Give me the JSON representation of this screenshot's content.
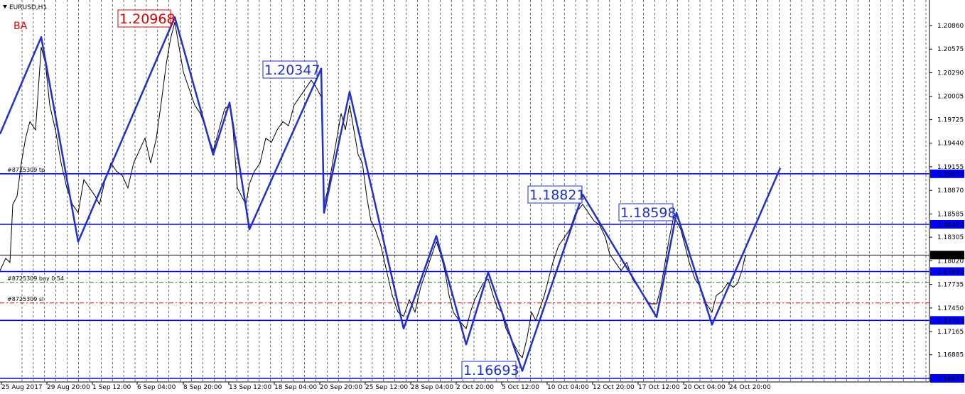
{
  "symbol_title": "EURUSD,H1",
  "indicator_label": "BA",
  "colors": {
    "level_line": "#0000ff",
    "zigzag": "#1f2fd4",
    "price_line": "#000000",
    "current_price_bg": "#000000",
    "level_badge_bg": "#0000ff",
    "high_label_red": "#e00000",
    "grid": "#000000"
  },
  "order_labels": {
    "tp": "#8725309 tp",
    "buy": "#8725309 buy 0.54",
    "sl": "#8725309 sl"
  },
  "price_labels": [
    {
      "text": "1.20968",
      "color": "red"
    },
    {
      "text": "1.20347",
      "color": "blue"
    },
    {
      "text": "1.18821",
      "color": "blue"
    },
    {
      "text": "1.18598",
      "color": "blue"
    },
    {
      "text": "1.16693",
      "color": "blue"
    }
  ],
  "chart_data": {
    "type": "line",
    "ylim": [
      1.1655,
      1.2106
    ],
    "y_ticks": [
      "1.20860",
      "1.20575",
      "1.20290",
      "1.20005",
      "1.19725",
      "1.19440",
      "1.19155",
      "1.18870",
      "1.18585",
      "1.18305",
      "1.18020",
      "1.17735",
      "1.17450",
      "1.17165",
      "1.16885",
      "1.16600"
    ],
    "x_ticks": [
      "25 Aug 2017",
      "29 Aug 20:00",
      "1 Sep 12:00",
      "6 Sep 04:00",
      "8 Sep 20:00",
      "13 Sep 12:00",
      "18 Sep 04:00",
      "20 Sep 20:00",
      "25 Sep 12:00",
      "28 Sep 04:00",
      "2 Oct 20:00",
      "5 Oct 12:00",
      "10 Oct 04:00",
      "12 Oct 20:00",
      "17 Oct 12:00",
      "20 Oct 04:00",
      "24 Oct 20:00"
    ],
    "horizontal_levels": [
      {
        "value": 1.1907,
        "label": "1.19070"
      },
      {
        "value": 1.1846,
        "label": "1.18460"
      },
      {
        "value": 1.1789,
        "label": "1.17890"
      },
      {
        "value": 1.173,
        "label": "1.17300"
      },
      {
        "value": 1.166,
        "label": "1.16600"
      }
    ],
    "current_price": {
      "value": 1.18089,
      "label": "1.18089"
    },
    "buy_level": 1.1776,
    "sl_level": 1.1751,
    "zigzag": [
      [
        0,
        1.1955
      ],
      [
        58,
        1.2072
      ],
      [
        110,
        1.1825
      ],
      [
        246,
        1.2096
      ],
      [
        300,
        1.193
      ],
      [
        323,
        1.1993
      ],
      [
        351,
        1.184
      ],
      [
        452,
        1.2034
      ],
      [
        456,
        1.186
      ],
      [
        492,
        1.2006
      ],
      [
        568,
        1.172
      ],
      [
        614,
        1.1832
      ],
      [
        656,
        1.1701
      ],
      [
        687,
        1.1788
      ],
      [
        735,
        1.1669
      ],
      [
        820,
        1.1882
      ],
      [
        924,
        1.1734
      ],
      [
        952,
        1.186
      ],
      [
        1002,
        1.1725
      ],
      [
        1098,
        1.1914
      ]
    ],
    "price_series": [
      [
        0,
        1.179
      ],
      [
        8,
        1.1805
      ],
      [
        14,
        1.18
      ],
      [
        18,
        1.187
      ],
      [
        24,
        1.188
      ],
      [
        30,
        1.192
      ],
      [
        36,
        1.195
      ],
      [
        42,
        1.197
      ],
      [
        50,
        1.196
      ],
      [
        58,
        1.206
      ],
      [
        64,
        1.204
      ],
      [
        70,
        1.199
      ],
      [
        78,
        1.196
      ],
      [
        86,
        1.192
      ],
      [
        94,
        1.189
      ],
      [
        102,
        1.187
      ],
      [
        110,
        1.186
      ],
      [
        118,
        1.19
      ],
      [
        126,
        1.189
      ],
      [
        134,
        1.188
      ],
      [
        140,
        1.187
      ],
      [
        148,
        1.19
      ],
      [
        156,
        1.192
      ],
      [
        164,
        1.191
      ],
      [
        172,
        1.1905
      ],
      [
        180,
        1.189
      ],
      [
        188,
        1.192
      ],
      [
        196,
        1.1935
      ],
      [
        204,
        1.195
      ],
      [
        212,
        1.192
      ],
      [
        220,
        1.195
      ],
      [
        228,
        1.2
      ],
      [
        234,
        1.204
      ],
      [
        240,
        1.207
      ],
      [
        246,
        1.209
      ],
      [
        252,
        1.206
      ],
      [
        258,
        1.203
      ],
      [
        266,
        1.201
      ],
      [
        274,
        1.199
      ],
      [
        282,
        1.198
      ],
      [
        290,
        1.196
      ],
      [
        300,
        1.1935
      ],
      [
        308,
        1.196
      ],
      [
        316,
        1.1985
      ],
      [
        323,
        1.199
      ],
      [
        328,
        1.196
      ],
      [
        334,
        1.189
      ],
      [
        340,
        1.188
      ],
      [
        346,
        1.187
      ],
      [
        351,
        1.1895
      ],
      [
        358,
        1.191
      ],
      [
        366,
        1.192
      ],
      [
        374,
        1.195
      ],
      [
        382,
        1.1945
      ],
      [
        390,
        1.196
      ],
      [
        398,
        1.197
      ],
      [
        406,
        1.1965
      ],
      [
        414,
        1.199
      ],
      [
        422,
        1.2
      ],
      [
        430,
        1.201
      ],
      [
        438,
        1.202
      ],
      [
        446,
        1.201
      ],
      [
        452,
        1.2
      ],
      [
        456,
        1.187
      ],
      [
        462,
        1.189
      ],
      [
        468,
        1.192
      ],
      [
        474,
        1.195
      ],
      [
        480,
        1.198
      ],
      [
        486,
        1.196
      ],
      [
        492,
        1.199
      ],
      [
        498,
        1.196
      ],
      [
        504,
        1.193
      ],
      [
        510,
        1.192
      ],
      [
        516,
        1.188
      ],
      [
        522,
        1.185
      ],
      [
        528,
        1.184
      ],
      [
        536,
        1.182
      ],
      [
        544,
        1.179
      ],
      [
        552,
        1.176
      ],
      [
        560,
        1.174
      ],
      [
        568,
        1.1735
      ],
      [
        576,
        1.1755
      ],
      [
        584,
        1.174
      ],
      [
        592,
        1.177
      ],
      [
        600,
        1.179
      ],
      [
        608,
        1.181
      ],
      [
        614,
        1.1825
      ],
      [
        620,
        1.181
      ],
      [
        626,
        1.179
      ],
      [
        632,
        1.176
      ],
      [
        638,
        1.174
      ],
      [
        646,
        1.173
      ],
      [
        656,
        1.172
      ],
      [
        662,
        1.174
      ],
      [
        668,
        1.1755
      ],
      [
        674,
        1.1765
      ],
      [
        680,
        1.1775
      ],
      [
        687,
        1.178
      ],
      [
        694,
        1.176
      ],
      [
        700,
        1.1745
      ],
      [
        706,
        1.174
      ],
      [
        712,
        1.172
      ],
      [
        718,
        1.171
      ],
      [
        724,
        1.17
      ],
      [
        730,
        1.169
      ],
      [
        735,
        1.1685
      ],
      [
        742,
        1.171
      ],
      [
        748,
        1.174
      ],
      [
        754,
        1.173
      ],
      [
        760,
        1.1745
      ],
      [
        766,
        1.176
      ],
      [
        772,
        1.178
      ],
      [
        778,
        1.18
      ],
      [
        786,
        1.182
      ],
      [
        794,
        1.183
      ],
      [
        802,
        1.184
      ],
      [
        810,
        1.186
      ],
      [
        820,
        1.187
      ],
      [
        828,
        1.186
      ],
      [
        836,
        1.185
      ],
      [
        844,
        1.1845
      ],
      [
        852,
        1.183
      ],
      [
        858,
        1.181
      ],
      [
        866,
        1.18
      ],
      [
        874,
        1.179
      ],
      [
        882,
        1.18
      ],
      [
        890,
        1.178
      ],
      [
        898,
        1.177
      ],
      [
        906,
        1.176
      ],
      [
        914,
        1.175
      ],
      [
        924,
        1.175
      ],
      [
        930,
        1.177
      ],
      [
        936,
        1.18
      ],
      [
        942,
        1.183
      ],
      [
        948,
        1.1855
      ],
      [
        952,
        1.185
      ],
      [
        958,
        1.184
      ],
      [
        964,
        1.182
      ],
      [
        970,
        1.18
      ],
      [
        978,
        1.178
      ],
      [
        986,
        1.177
      ],
      [
        994,
        1.175
      ],
      [
        1002,
        1.174
      ],
      [
        1008,
        1.176
      ],
      [
        1016,
        1.1765
      ],
      [
        1024,
        1.1775
      ],
      [
        1032,
        1.177
      ],
      [
        1038,
        1.1775
      ],
      [
        1044,
        1.179
      ],
      [
        1048,
        1.1805
      ],
      [
        1050,
        1.1809
      ]
    ],
    "grid": true,
    "xrange": [
      0,
      1308
    ]
  }
}
